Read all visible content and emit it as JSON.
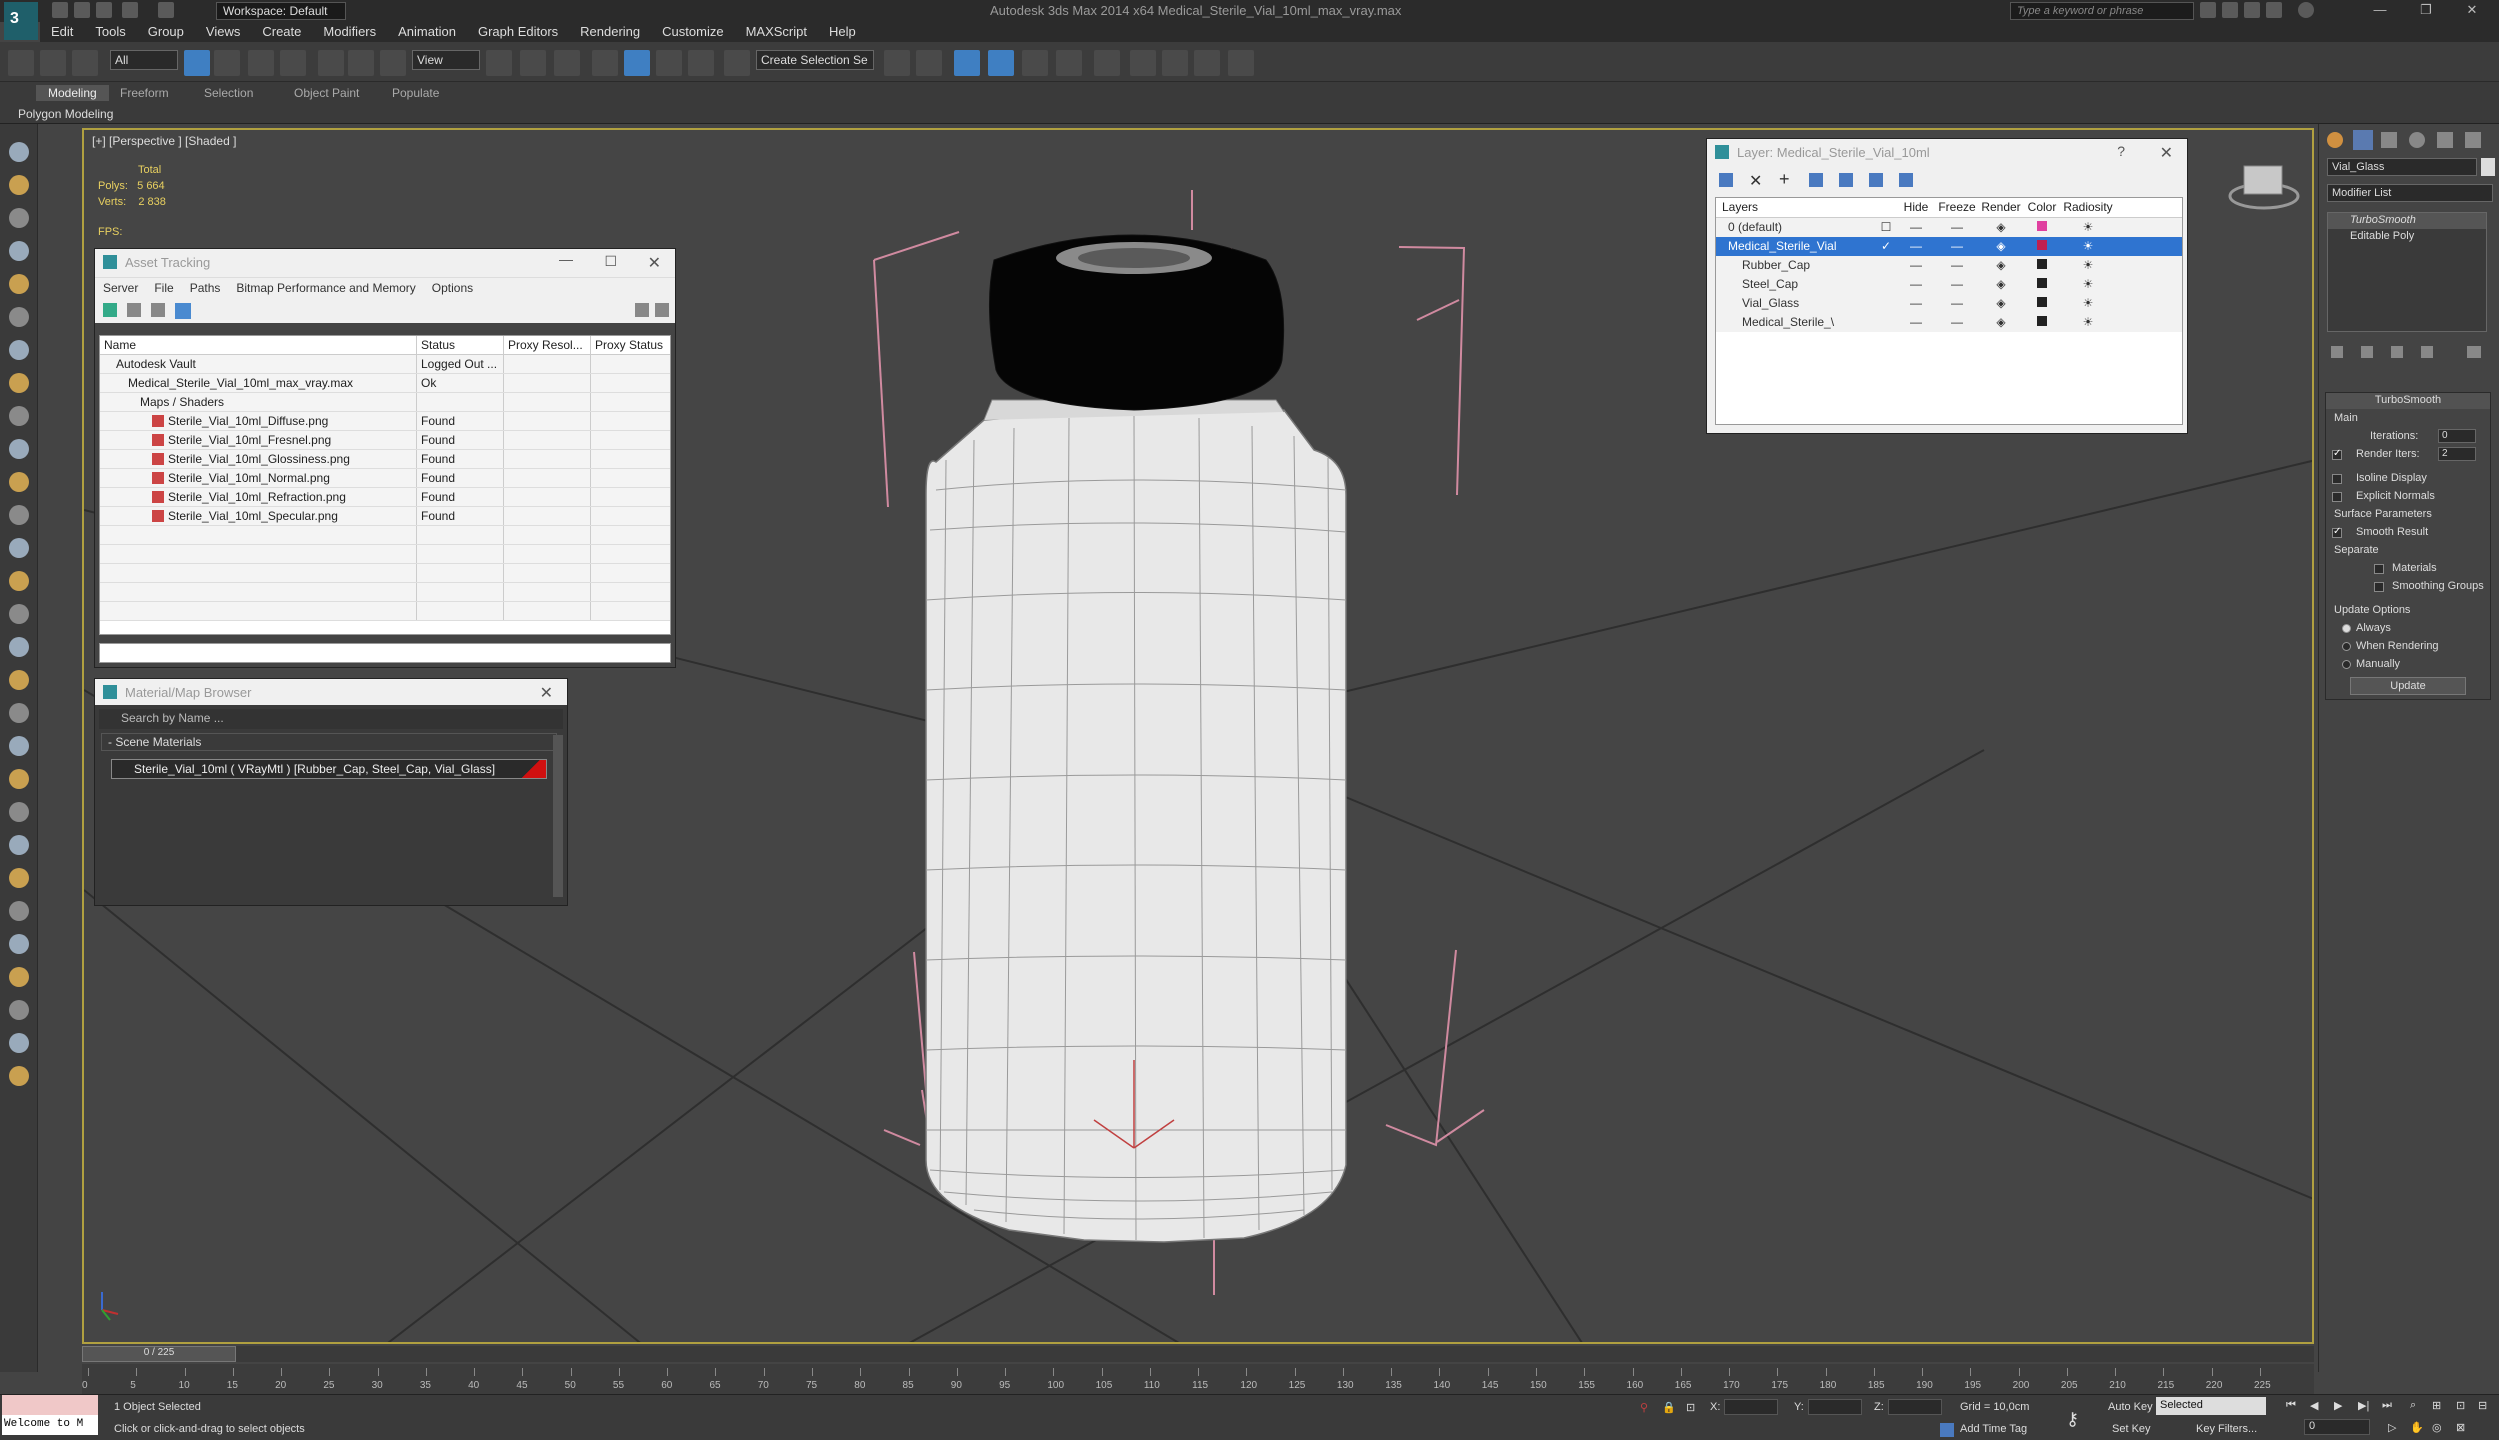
{
  "window": {
    "title": "Autodesk 3ds Max  2014 x64      Medical_Sterile_Vial_10ml_max_vray.max",
    "workspace": "Workspace: Default",
    "search_placeholder": "Type a keyword or phrase"
  },
  "menu": [
    "Edit",
    "Tools",
    "Group",
    "Views",
    "Create",
    "Modifiers",
    "Animation",
    "Graph Editors",
    "Rendering",
    "Customize",
    "MAXScript",
    "Help"
  ],
  "toolbar": {
    "selection_filter": "All",
    "ref_coord": "View",
    "selection_set": "Create Selection Se"
  },
  "ribbon": {
    "tabs": [
      "Modeling",
      "Freeform",
      "Selection",
      "Object Paint",
      "Populate"
    ],
    "active_tab": "Modeling",
    "sub_label": "Polygon Modeling"
  },
  "viewport": {
    "label": "[+] [Perspective ] [Shaded ]",
    "stats": {
      "total_label": "Total",
      "polys_label": "Polys:",
      "polys": "5 664",
      "verts_label": "Verts:",
      "verts": "2 838",
      "fps_label": "FPS:"
    }
  },
  "asset_tracking": {
    "title": "Asset Tracking",
    "menu": [
      "Server",
      "File",
      "Paths",
      "Bitmap Performance and Memory",
      "Options"
    ],
    "columns": [
      "Name",
      "Status",
      "Proxy Resol...",
      "Proxy Status"
    ],
    "rows": [
      {
        "name": "Autodesk Vault",
        "status": "Logged Out ...",
        "indent": 1
      },
      {
        "name": "Medical_Sterile_Vial_10ml_max_vray.max",
        "status": "Ok",
        "indent": 2
      },
      {
        "name": "Maps / Shaders",
        "status": "",
        "indent": 3
      },
      {
        "name": "Sterile_Vial_10ml_Diffuse.png",
        "status": "Found",
        "indent": 4
      },
      {
        "name": "Sterile_Vial_10ml_Fresnel.png",
        "status": "Found",
        "indent": 4
      },
      {
        "name": "Sterile_Vial_10ml_Glossiness.png",
        "status": "Found",
        "indent": 4
      },
      {
        "name": "Sterile_Vial_10ml_Normal.png",
        "status": "Found",
        "indent": 4
      },
      {
        "name": "Sterile_Vial_10ml_Refraction.png",
        "status": "Found",
        "indent": 4
      },
      {
        "name": "Sterile_Vial_10ml_Specular.png",
        "status": "Found",
        "indent": 4
      }
    ]
  },
  "material_browser": {
    "title": "Material/Map Browser",
    "search_placeholder": "Search by Name ...",
    "group": "- Scene Materials",
    "item": "Sterile_Vial_10ml  ( VRayMtl ) [Rubber_Cap, Steel_Cap, Vial_Glass]"
  },
  "layers": {
    "title": "Layer: Medical_Sterile_Vial_10ml",
    "columns": [
      "Layers",
      "Hide",
      "Freeze",
      "Render",
      "Color",
      "Radiosity"
    ],
    "rows": [
      {
        "name": "0 (default)",
        "color": "#e040a0",
        "selected": false
      },
      {
        "name": "Medical_Sterile_Vial",
        "color": "#c02050",
        "selected": true
      },
      {
        "name": "Rubber_Cap",
        "color": "#222222",
        "selected": false
      },
      {
        "name": "Steel_Cap",
        "color": "#222222",
        "selected": false
      },
      {
        "name": "Vial_Glass",
        "color": "#222222",
        "selected": false
      },
      {
        "name": "Medical_Sterile_\\",
        "color": "#222222",
        "selected": false
      }
    ]
  },
  "command_panel": {
    "object_name": "Vial_Glass",
    "modifier_list": "Modifier List",
    "stack": [
      "TurboSmooth",
      "Editable Poly"
    ],
    "turbosmooth": {
      "title": "TurboSmooth",
      "main": "Main",
      "iterations_label": "Iterations:",
      "iterations": "0",
      "render_iters_label": "Render Iters:",
      "render_iters": "2",
      "isoline": "Isoline Display",
      "explicit": "Explicit Normals",
      "surface": "Surface Parameters",
      "smooth_result": "Smooth Result",
      "separate": "Separate",
      "materials": "Materials",
      "smoothing_groups": "Smoothing Groups",
      "update_options": "Update Options",
      "always": "Always",
      "when_rendering": "When Rendering",
      "manually": "Manually",
      "update_btn": "Update"
    }
  },
  "timeline": {
    "slider": "0 / 225",
    "ticks": [
      "0",
      "5",
      "10",
      "15",
      "20",
      "25",
      "30",
      "35",
      "40",
      "45",
      "50",
      "55",
      "60",
      "65",
      "70",
      "75",
      "80",
      "85",
      "90",
      "95",
      "100",
      "105",
      "110",
      "115",
      "120",
      "125",
      "130",
      "135",
      "140",
      "145",
      "150",
      "155",
      "160",
      "165",
      "170",
      "175",
      "180",
      "185",
      "190",
      "195",
      "200",
      "205",
      "210",
      "215",
      "220",
      "225"
    ]
  },
  "status": {
    "maxscript": "Welcome to M",
    "selected": "1 Object Selected",
    "prompt": "Click or click-and-drag to select objects",
    "x_label": "X:",
    "y_label": "Y:",
    "z_label": "Z:",
    "grid": "Grid = 10,0cm",
    "add_time_tag": "Add Time Tag",
    "auto_key": "Auto Key",
    "auto_key_mode": "Selected",
    "set_key": "Set Key",
    "key_filters": "Key Filters...",
    "frame": "0"
  }
}
